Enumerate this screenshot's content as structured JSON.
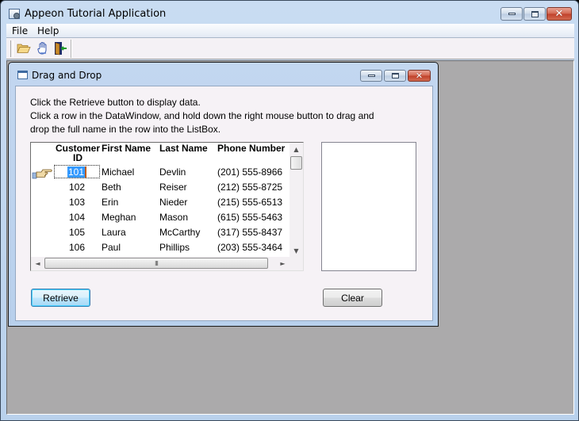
{
  "app": {
    "title": "Appeon Tutorial Application",
    "window_buttons": {
      "minimize": "minimize",
      "maximize": "maximize",
      "close": "close"
    }
  },
  "menu": {
    "items": [
      {
        "label": "File"
      },
      {
        "label": "Help"
      }
    ]
  },
  "toolbar": {
    "buttons": [
      {
        "icon": "open-folder-icon"
      },
      {
        "icon": "drag-hand-icon"
      },
      {
        "icon": "exit-door-icon"
      }
    ]
  },
  "child_window": {
    "title": "Drag and Drop",
    "instructions": [
      "Click the Retrieve button to display data.",
      "Click a row in the DataWindow, and hold down the right mouse button to drag and",
      "drop the full name in the row into the ListBox."
    ],
    "datawindow": {
      "columns": {
        "id_line1": "Customer",
        "id_line2": "ID",
        "first_name": "First Name",
        "last_name": "Last Name",
        "phone": "Phone Number"
      },
      "rows": [
        {
          "id": "101",
          "first_name": "Michael",
          "last_name": "Devlin",
          "phone": "(201) 555-8966"
        },
        {
          "id": "102",
          "first_name": "Beth",
          "last_name": "Reiser",
          "phone": "(212) 555-8725"
        },
        {
          "id": "103",
          "first_name": "Erin",
          "last_name": "Nieder",
          "phone": "(215) 555-6513"
        },
        {
          "id": "104",
          "first_name": "Meghan",
          "last_name": "Mason",
          "phone": "(615) 555-5463"
        },
        {
          "id": "105",
          "first_name": "Laura",
          "last_name": "McCarthy",
          "phone": "(317) 555-8437"
        },
        {
          "id": "106",
          "first_name": "Paul",
          "last_name": "Phillips",
          "phone": "(203) 555-3464"
        }
      ],
      "current_row": 0,
      "scroll": {
        "up_arrow": "▲",
        "down_arrow": "▼",
        "left_arrow": "◄",
        "right_arrow": "►",
        "thumb_grip": "III"
      }
    },
    "listbox": {
      "items": []
    },
    "buttons": {
      "retrieve": "Retrieve",
      "clear": "Clear"
    }
  }
}
